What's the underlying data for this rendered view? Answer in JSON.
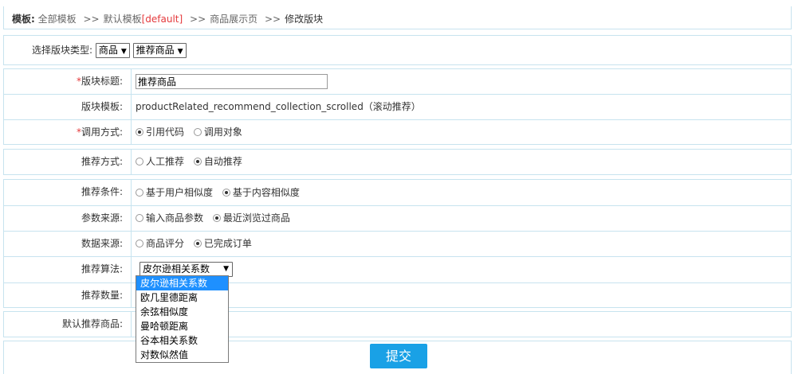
{
  "breadcrumb": {
    "label": "模板:",
    "all_templates": "全部模板",
    "sep": ">>",
    "default_template": "默认模板",
    "default_tag": "[default]",
    "product_page": "商品展示页",
    "current": "修改版块"
  },
  "type_select": {
    "label": "选择版块类型:",
    "type_value": "商品",
    "sub_value": "推荐商品"
  },
  "form": {
    "title_label": "版块标题:",
    "title_value": "推荐商品",
    "template_label": "版块模板:",
    "template_value": "productRelated_recommend_collection_scrolled（滚动推荐）",
    "call_label": "调用方式:",
    "call_options": [
      "引用代码",
      "调用对象"
    ],
    "recommend_way_label": "推荐方式:",
    "recommend_way_options": [
      "人工推荐",
      "自动推荐"
    ],
    "condition_label": "推荐条件:",
    "condition_options": [
      "基于用户相似度",
      "基于内容相似度"
    ],
    "param_source_label": "参数来源:",
    "param_source_options": [
      "输入商品参数",
      "最近浏览过商品"
    ],
    "data_source_label": "数据来源:",
    "data_source_options": [
      "商品评分",
      "已完成订单"
    ],
    "algorithm_label": "推荐算法:",
    "algorithm_value": "皮尔逊相关系数",
    "count_label": "推荐数量:",
    "default_goods_label": "默认推荐商品:"
  },
  "algorithm_options": [
    "皮尔逊相关系数",
    "欧几里德距离",
    "余弦相似度",
    "曼哈顿距离",
    "谷本相关系数",
    "对数似然值"
  ],
  "submit_label": "提交",
  "colors": {
    "border": "#c7e3ef",
    "accent": "#19a1e6",
    "required": "#e4393c",
    "highlight": "#1e90ff"
  }
}
